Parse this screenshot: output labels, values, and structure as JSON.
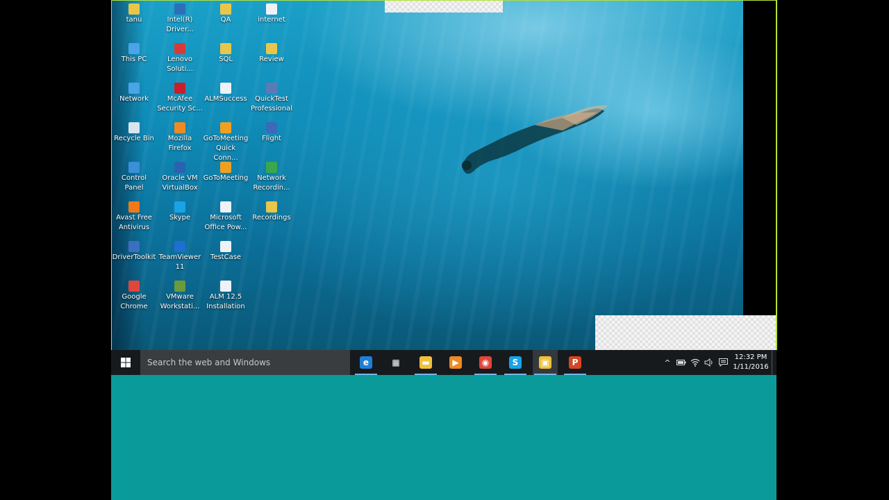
{
  "desktop_icons": [
    {
      "label": "tanu",
      "icon": "folder-icon",
      "color": "#e8c64a"
    },
    {
      "label": "This PC",
      "icon": "computer-icon",
      "color": "#4aa4e8"
    },
    {
      "label": "Network",
      "icon": "network-icon",
      "color": "#4aa4e8"
    },
    {
      "label": "Recycle Bin",
      "icon": "recycle-bin-icon",
      "color": "#d8e4ee"
    },
    {
      "label": "Control Panel",
      "icon": "control-panel-icon",
      "color": "#3a8fd8"
    },
    {
      "label": "Avast Free\nAntivirus",
      "icon": "avast-icon",
      "color": "#f07a18"
    },
    {
      "label": "DriverToolkit",
      "icon": "driver-toolkit-icon",
      "color": "#3b6fc0"
    },
    {
      "label": "Google\nChrome",
      "icon": "chrome-icon",
      "color": "#e0463a"
    },
    {
      "label": "Intel(R)\nDriver...",
      "icon": "intel-icon",
      "color": "#2c6fb8"
    },
    {
      "label": "Lenovo\nSoluti...",
      "icon": "lenovo-icon",
      "color": "#d83a3a"
    },
    {
      "label": "McAfee\nSecurity Sc...",
      "icon": "mcafee-icon",
      "color": "#c8202a"
    },
    {
      "label": "Mozilla\nFirefox",
      "icon": "firefox-icon",
      "color": "#f08a24"
    },
    {
      "label": "Oracle VM\nVirtualBox",
      "icon": "virtualbox-icon",
      "color": "#2a62b0"
    },
    {
      "label": "Skype",
      "icon": "skype-icon",
      "color": "#1aa3e6"
    },
    {
      "label": "TeamViewer\n11",
      "icon": "teamviewer-icon",
      "color": "#1e6fd0"
    },
    {
      "label": "VMware\nWorkstati...",
      "icon": "vmware-icon",
      "color": "#6a9a3a"
    },
    {
      "label": "QA",
      "icon": "folder-icon",
      "color": "#e8c64a"
    },
    {
      "label": "SQL",
      "icon": "folder-icon",
      "color": "#e8c64a"
    },
    {
      "label": "ALMSuccess",
      "icon": "document-icon",
      "color": "#eef2f6"
    },
    {
      "label": "GoToMeeting\nQuick Conn...",
      "icon": "gotomeeting-icon",
      "color": "#f0a020"
    },
    {
      "label": "GoToMeeting",
      "icon": "gotomeeting-icon",
      "color": "#f0a020"
    },
    {
      "label": "Microsoft\nOffice Pow...",
      "icon": "document-icon",
      "color": "#eef2f6"
    },
    {
      "label": "TestCase",
      "icon": "document-icon",
      "color": "#eef2f6"
    },
    {
      "label": "ALM 12.5\nInstallation",
      "icon": "document-icon",
      "color": "#eef2f6"
    },
    {
      "label": "internet",
      "icon": "document-icon",
      "color": "#eef2f6"
    },
    {
      "label": "Review",
      "icon": "folder-icon",
      "color": "#e8c64a"
    },
    {
      "label": "QuickTest\nProfessional",
      "icon": "quicktest-icon",
      "color": "#5a7ab8"
    },
    {
      "label": "Flight",
      "icon": "flight-icon",
      "color": "#3a6ab8"
    },
    {
      "label": "Network\nRecordin...",
      "icon": "network-recording-icon",
      "color": "#3aa84a"
    },
    {
      "label": "Recordings",
      "icon": "folder-icon",
      "color": "#e8c64a"
    }
  ],
  "taskbar": {
    "search_placeholder": "Search the web and Windows",
    "apps": [
      {
        "name": "edge-icon",
        "glyph": "e",
        "color": "#1e7fd8",
        "open": true
      },
      {
        "name": "store-icon",
        "glyph": "▦",
        "color": "#ffffff",
        "open": false
      },
      {
        "name": "file-explorer-icon",
        "glyph": "▬",
        "color": "#f0c23a",
        "open": true
      },
      {
        "name": "media-player-icon",
        "glyph": "▶",
        "color": "#f08a24",
        "open": false
      },
      {
        "name": "chrome-icon",
        "glyph": "◉",
        "color": "#e0463a",
        "open": true
      },
      {
        "name": "skype-icon",
        "glyph": "S",
        "color": "#1aa3e6",
        "open": true
      },
      {
        "name": "virtualbox-icon",
        "glyph": "▣",
        "color": "#f0c23a",
        "open": true
      },
      {
        "name": "powerpoint-icon",
        "glyph": "P",
        "color": "#d24726",
        "open": true
      }
    ],
    "tray": {
      "clock_time": "12:32 PM",
      "clock_date": "1/11/2016"
    }
  }
}
